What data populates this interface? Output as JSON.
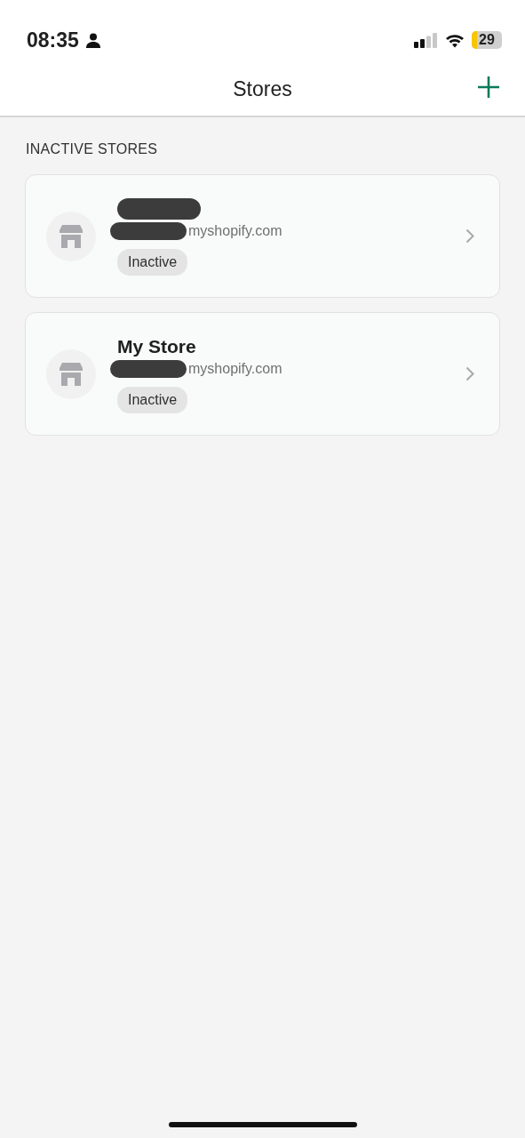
{
  "status_bar": {
    "time": "08:35",
    "battery": "29"
  },
  "header": {
    "title": "Stores"
  },
  "section": {
    "title": "INACTIVE STORES"
  },
  "stores": [
    {
      "name_redacted": true,
      "domain": "myshopify.com",
      "domain_redacted": true,
      "status": "Inactive"
    },
    {
      "name": "My Store",
      "name_redacted": false,
      "domain": "myshopify.com",
      "domain_redacted": true,
      "status": "Inactive"
    }
  ]
}
